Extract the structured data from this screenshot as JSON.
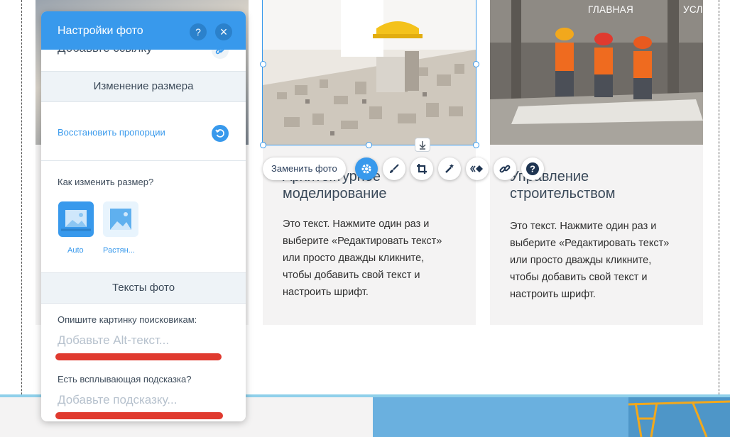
{
  "nav": {
    "item1": "ГЛАВНАЯ",
    "item2": "УСЛ"
  },
  "toolbar": {
    "replace_label": "Заменить фото",
    "icons": [
      "settings-icon",
      "brush-icon",
      "crop-icon",
      "magic-wand-icon",
      "animation-icon",
      "link-icon",
      "help-icon"
    ]
  },
  "cards": [
    {
      "title_line1": "Архитектурное",
      "title_line2": "моделирование",
      "body": [
        "Это текст. Нажмите один раз и",
        "выберите «Редактировать текст»",
        "или просто дважды кликните,",
        "чтобы добавить свой текст и",
        "настроить шрифт."
      ]
    },
    {
      "title_line1": "Управление",
      "title_line2": "строительством",
      "body": [
        "Это текст. Нажмите один раз и",
        "выберите «Редактировать текст»",
        "или просто дважды кликните,",
        "чтобы добавить свой текст и",
        "настроить шрифт."
      ]
    }
  ],
  "panel": {
    "title": "Настройки фото",
    "help": "?",
    "close": "×",
    "add_link": "Добавьте ссылку",
    "resize_section": "Изменение размера",
    "restore_proportions": "Восстановить пропорции",
    "how_resize": "Как изменить размер?",
    "option_auto": "Auto",
    "option_stretch": "Растян...",
    "texts_section": "Тексты фото",
    "alt_label": "Опишите картинку поисковикам:",
    "alt_placeholder": "Добавьте Alt-текст...",
    "tooltip_label": "Есть всплывающая подсказка?",
    "tooltip_placeholder": "Добавьте подсказку..."
  },
  "colors": {
    "accent": "#3899ec",
    "highlight": "#e03a2f",
    "card_bg": "#f4f3f3"
  }
}
